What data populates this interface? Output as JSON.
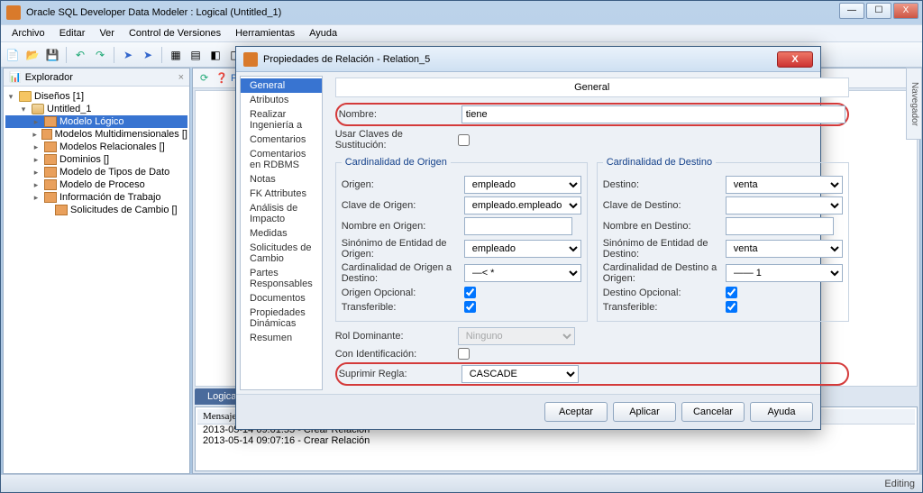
{
  "app": {
    "title": "Oracle SQL Developer Data Modeler : Logical (Untitled_1)"
  },
  "menu": {
    "items": [
      "Archivo",
      "Editar",
      "Ver",
      "Control de Versiones",
      "Herramientas",
      "Ayuda"
    ]
  },
  "explorer": {
    "tab": "Explorador",
    "root": "Diseños [1]",
    "untitled": "Untitled_1",
    "items": [
      "Modelo Lógico",
      "Modelos Multidimensionales []",
      "Modelos Relacionales []",
      "Dominios []",
      "Modelo de Tipos de Dato",
      "Modelo de Proceso",
      "Información de Trabajo",
      "Solicitudes de Cambio []"
    ]
  },
  "content": {
    "startpage": "Página",
    "bottom_tab": "Logical"
  },
  "right_dock": "Navegador",
  "messages": {
    "title": "Mensajes - Log",
    "lines": [
      "2013-05-14 09:01:55 - Crear Relación",
      "2013-05-14 09:07:16 - Crear Relación"
    ]
  },
  "status": {
    "right": "Editing"
  },
  "dialog": {
    "title": "Propiedades de Relación - Relation_5",
    "nav": [
      "General",
      "Atributos",
      "Realizar Ingeniería a",
      "Comentarios",
      "Comentarios en RDBMS",
      "Notas",
      "FK Attributes",
      "Análisis de Impacto",
      "Medidas",
      "Solicitudes de Cambio",
      "Partes Responsables",
      "Documentos",
      "Propiedades Dinámicas",
      "Resumen"
    ],
    "section_general": "General",
    "labels": {
      "nombre": "Nombre:",
      "usar_claves": "Usar Claves de Sustitución:",
      "card_origen": "Cardinalidad de Origen",
      "card_destino": "Cardinalidad de Destino",
      "origen": "Origen:",
      "destino": "Destino:",
      "clave_origen": "Clave de Origen:",
      "clave_destino": "Clave de Destino:",
      "nombre_origen": "Nombre en Origen:",
      "nombre_destino": "Nombre en Destino:",
      "sin_origen": "Sinónimo de Entidad de Origen:",
      "sin_destino": "Sinónimo de Entidad de Destino:",
      "card_o_d": "Cardinalidad de Origen a Destino:",
      "card_d_o": "Cardinalidad de Destino a Origen:",
      "origen_opcional": "Origen Opcional:",
      "destino_opcional": "Destino Opcional:",
      "transferible": "Transferible:",
      "rol_dominante": "Rol Dominante:",
      "con_ident": "Con Identificación:",
      "suprimir": "Suprimir Regla:"
    },
    "values": {
      "nombre": "tiene",
      "origen": "empleado",
      "destino": "venta",
      "clave_origen": "empleado.empleado PK",
      "sin_origen": "empleado",
      "sin_destino": "venta",
      "card_o_d": "—< *",
      "card_d_o": "—— 1",
      "rol_dominante": "Ninguno",
      "suprimir": "CASCADE"
    },
    "buttons": {
      "ok": "Aceptar",
      "apply": "Aplicar",
      "cancel": "Cancelar",
      "help": "Ayuda"
    }
  }
}
